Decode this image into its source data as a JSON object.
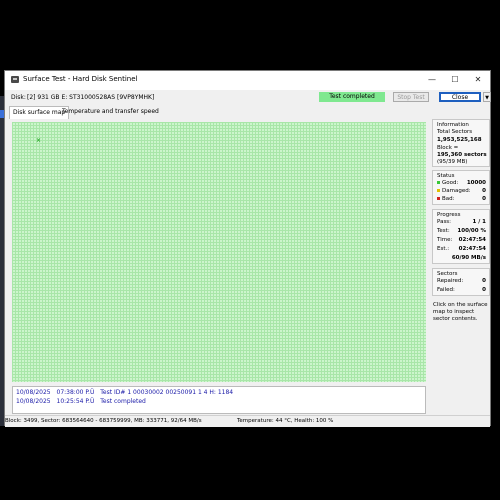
{
  "window": {
    "title": "Surface Test - Hard Disk Sentinel",
    "minimize": "—",
    "maximize": "☐",
    "close": "✕"
  },
  "toolbar": {
    "disk_label": "Disk:",
    "disk_name": "[2] 931 GB E: ST31000528AS [9VP8YMHK]",
    "status": "Test completed",
    "stop_label": "Stop Test",
    "close_label": "Close",
    "status_color": "#7fe890"
  },
  "tabs": [
    {
      "label": "Disk surface map",
      "active": true
    },
    {
      "label": "Temperature and transfer speed",
      "active": false
    }
  ],
  "map": {
    "block_color": "#ccf5cc",
    "marker": "×"
  },
  "log": [
    {
      "date": "10/08/2025",
      "time": "07:38:00 P.Ü",
      "message": "Test ID# 1 00030002 00250091 1 4 H: 1184"
    },
    {
      "date": "10/08/2025",
      "time": "10:25:54 P.Ü",
      "message": "Test completed"
    }
  ],
  "info": {
    "title": "Information",
    "total_label": "Total Sectors",
    "total_value": "1,953,525,168",
    "block_label": "Block =",
    "block_value": "195,360 sectors",
    "block_size": "(95/39 MB)"
  },
  "status_group": {
    "title": "Status",
    "good_label": "Good:",
    "good_value": "10000",
    "good_color": "#39c739",
    "damaged_label": "Damaged:",
    "damaged_value": "0",
    "damaged_color": "#e0c000",
    "bad_label": "Bad:",
    "bad_value": "0",
    "bad_color": "#d02020"
  },
  "progress": {
    "title": "Progress",
    "pass_label": "Pass:",
    "pass_value": "1 / 1",
    "test_label": "Test:",
    "test_value": "100/00 %",
    "time_label": "Time:",
    "time_value": "02:47:54",
    "est_label": "Est.:",
    "est_value": "02:47:54",
    "speed_value": "60/90 MB/s"
  },
  "sectors": {
    "title": "Sectors",
    "repaired_label": "Repaired:",
    "repaired_value": "0",
    "failed_label": "Failed:",
    "failed_value": "0"
  },
  "hint": "Click on the surface map to inspect sector contents.",
  "statusbar": {
    "left": "Block: 3499, Sector: 683564640 - 683759999, MB: 333771, 92/64 MB/s",
    "right": "Temperature: 44 °C, Health: 100 %"
  }
}
